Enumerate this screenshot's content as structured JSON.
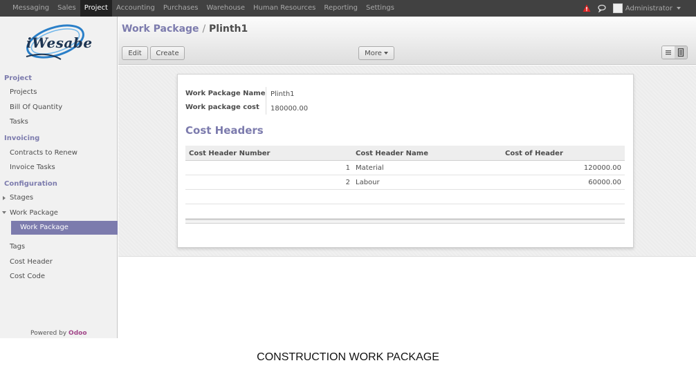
{
  "topbar": {
    "menu": [
      {
        "label": "Messaging",
        "active": false
      },
      {
        "label": "Sales",
        "active": false
      },
      {
        "label": "Project",
        "active": true
      },
      {
        "label": "Accounting",
        "active": false
      },
      {
        "label": "Purchases",
        "active": false
      },
      {
        "label": "Warehouse",
        "active": false
      },
      {
        "label": "Human Resources",
        "active": false
      },
      {
        "label": "Reporting",
        "active": false
      },
      {
        "label": "Settings",
        "active": false
      }
    ],
    "icons": [
      "alert-icon",
      "chat-icon"
    ],
    "user": "Administrator"
  },
  "sidebar": {
    "logo_text": "Wesabe",
    "logo_prefix": "i",
    "sections": {
      "project": {
        "title": "Project",
        "items": [
          "Projects",
          "Bill Of Quantity",
          "Tasks"
        ]
      },
      "invoicing": {
        "title": "Invoicing",
        "items": [
          "Contracts to Renew",
          "Invoice Tasks"
        ]
      },
      "configuration": {
        "title": "Configuration",
        "items": [
          "Stages",
          "Work Package",
          "Work Package",
          "Tags",
          "Cost Header",
          "Cost Code"
        ]
      }
    },
    "active_item": "Work Package",
    "powered_by": "Powered by",
    "powered_brand": "Odoo"
  },
  "control_panel": {
    "breadcrumb_parent": "Work Package",
    "breadcrumb_sep": "/",
    "breadcrumb_current": "Plinth1",
    "edit_label": "Edit",
    "create_label": "Create",
    "more_label": "More",
    "view_switch": [
      "list-view-icon",
      "form-view-icon"
    ],
    "active_view": "form"
  },
  "form": {
    "fields": [
      {
        "label": "Work Package Name",
        "value": "Plinth1"
      },
      {
        "label": "Work package cost",
        "value": "180000.00"
      }
    ],
    "section_title": "Cost Headers",
    "table": {
      "columns": [
        "Cost Header Number",
        "Cost Header Name",
        "Cost of Header"
      ],
      "rows": [
        [
          "1",
          "Material",
          "120000.00"
        ],
        [
          "2",
          "Labour",
          "60000.00"
        ]
      ]
    }
  },
  "caption": "CONSTRUCTION WORK PACKAGE",
  "colors": {
    "topbar": "#414141",
    "accent": "#7c7bad",
    "brand": "#a24689",
    "alert": "#e02424"
  }
}
